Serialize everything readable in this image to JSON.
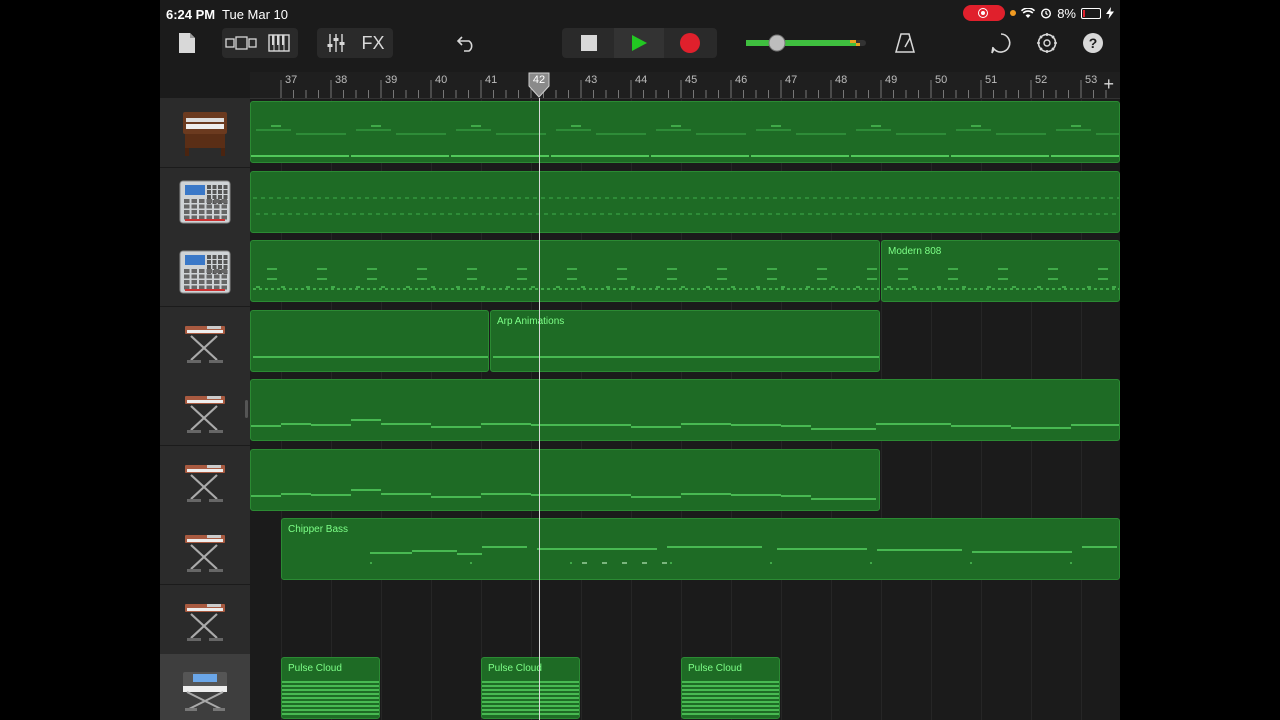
{
  "status": {
    "time": "6:24 PM",
    "date": "Tue Mar 10",
    "battery": "8%"
  },
  "toolbar": {
    "fx_label": "FX",
    "icons": [
      "document-icon",
      "track-view-icon",
      "keyboard-icon",
      "mixer-icon",
      "undo-icon",
      "stop-icon",
      "play-icon",
      "record-icon",
      "volume-slider",
      "metronome-icon",
      "loop-browser-icon",
      "settings-icon",
      "help-icon"
    ]
  },
  "colors": {
    "region": "#1e6b25",
    "region_border": "#2b8a33",
    "note": "#62e86d",
    "region_label": "#7dff87",
    "record": "#e0202c",
    "play": "#22c822"
  },
  "ruler": {
    "bars": [
      "37",
      "38",
      "39",
      "40",
      "41",
      "42",
      "43",
      "44",
      "45",
      "46",
      "47",
      "48",
      "49",
      "50",
      "51",
      "52",
      "53"
    ],
    "playhead_bar": "42"
  },
  "tracks": [
    {
      "instrument": "organ",
      "regions": [
        {
          "name": ""
        }
      ]
    },
    {
      "instrument": "drum-machine",
      "regions": [
        {
          "name": ""
        }
      ]
    },
    {
      "instrument": "drum-machine",
      "regions": [
        {
          "name": ""
        },
        {
          "name": "Modern 808"
        }
      ]
    },
    {
      "instrument": "synth-keyboard",
      "regions": [
        {
          "name": ""
        },
        {
          "name": "Arp Animations"
        }
      ]
    },
    {
      "instrument": "synth-keyboard",
      "regions": [
        {
          "name": ""
        }
      ]
    },
    {
      "instrument": "synth-keyboard",
      "regions": [
        {
          "name": ""
        }
      ]
    },
    {
      "instrument": "synth-keyboard",
      "regions": [
        {
          "name": "Chipper Bass"
        }
      ]
    },
    {
      "instrument": "synth-keyboard",
      "regions": []
    },
    {
      "instrument": "synth-workstation",
      "regions": [
        {
          "name": "Pulse Cloud"
        },
        {
          "name": "Pulse Cloud"
        },
        {
          "name": "Pulse Cloud"
        }
      ]
    }
  ]
}
